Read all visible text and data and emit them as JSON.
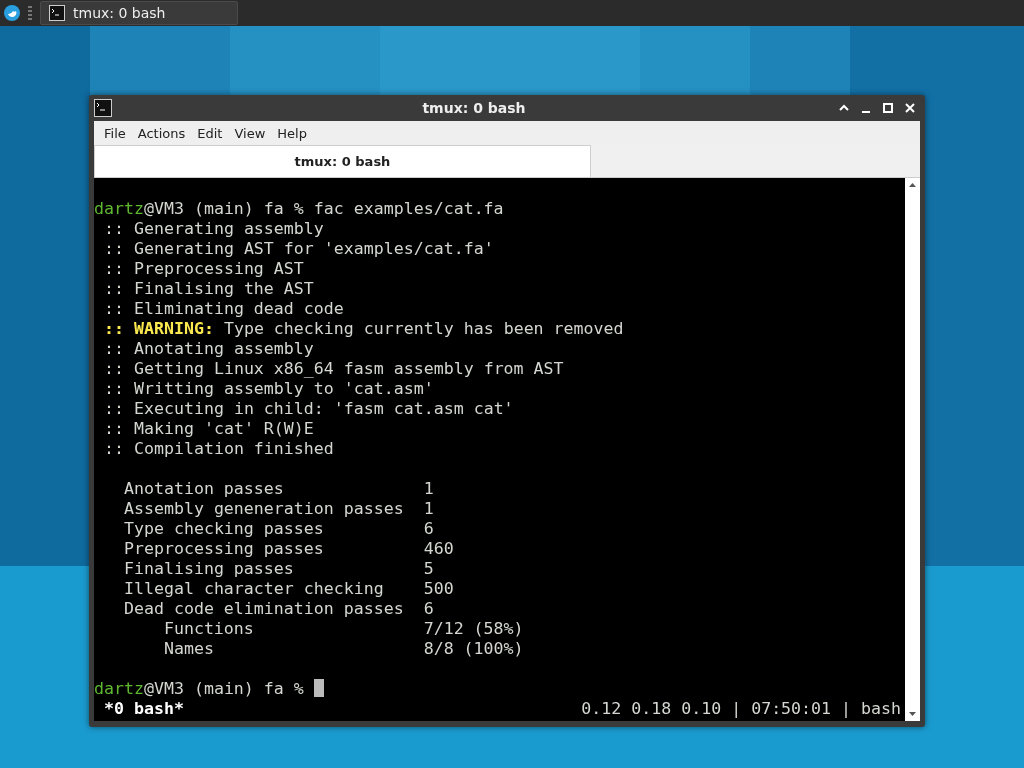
{
  "taskbar": {
    "tasks": [
      {
        "label": "tmux: 0 bash",
        "selected": true
      }
    ]
  },
  "window": {
    "title": "tmux: 0 bash",
    "menu": [
      "File",
      "Actions",
      "Edit",
      "View",
      "Help"
    ],
    "tabs": [
      {
        "label": "tmux: 0 bash",
        "selected": true
      }
    ],
    "terminal": {
      "lines": [
        {
          "kind": "blank"
        },
        {
          "kind": "prompt",
          "user": "dartz",
          "rest": "@VM3 (main) fa % fac examples/cat.fa"
        },
        {
          "kind": "log",
          "marker": "::",
          "text": "Generating assembly"
        },
        {
          "kind": "log",
          "marker": "::",
          "text": "Generating AST for 'examples/cat.fa'"
        },
        {
          "kind": "log",
          "marker": "::",
          "text": "Preprocessing AST"
        },
        {
          "kind": "log",
          "marker": "::",
          "text": "Finalising the AST"
        },
        {
          "kind": "log",
          "marker": "::",
          "text": "Eliminating dead code"
        },
        {
          "kind": "warning",
          "marker": "::",
          "label": "WARNING:",
          "text": "Type checking currently has been removed"
        },
        {
          "kind": "log",
          "marker": "::",
          "text": "Anotating assembly"
        },
        {
          "kind": "log",
          "marker": "::",
          "text": "Getting Linux x86_64 fasm assembly from AST"
        },
        {
          "kind": "log",
          "marker": "::",
          "text": "Writting assembly to 'cat.asm'"
        },
        {
          "kind": "log",
          "marker": "::",
          "text": "Executing in child: 'fasm cat.asm cat'"
        },
        {
          "kind": "log",
          "marker": "::",
          "text": "Making 'cat' R(W)E"
        },
        {
          "kind": "log",
          "marker": "::",
          "text": "Compilation finished"
        },
        {
          "kind": "blank"
        },
        {
          "kind": "stats",
          "rows": [
            {
              "label": "Anotation passes",
              "value": "1"
            },
            {
              "label": "Assembly geneneration passes",
              "value": "1"
            },
            {
              "label": "Type checking passes",
              "value": "6"
            },
            {
              "label": "Preprocessing passes",
              "value": "460"
            },
            {
              "label": "Finalising passes",
              "value": "5"
            },
            {
              "label": "Illegal character checking",
              "value": "500"
            },
            {
              "label": "Dead code elimination passes",
              "value": "6",
              "children": [
                {
                  "label": "Functions",
                  "value": "7/12 (58%)"
                },
                {
                  "label": "Names",
                  "value": "8/8 (100%)"
                }
              ]
            }
          ]
        },
        {
          "kind": "blank"
        },
        {
          "kind": "prompt",
          "user": "dartz",
          "rest": "@VM3 (main) fa % ",
          "cursor": true
        }
      ],
      "status_bar": {
        "left": "*0 bash*",
        "right": "0.12 0.18 0.10 | 07:50:01 | bash"
      }
    }
  }
}
